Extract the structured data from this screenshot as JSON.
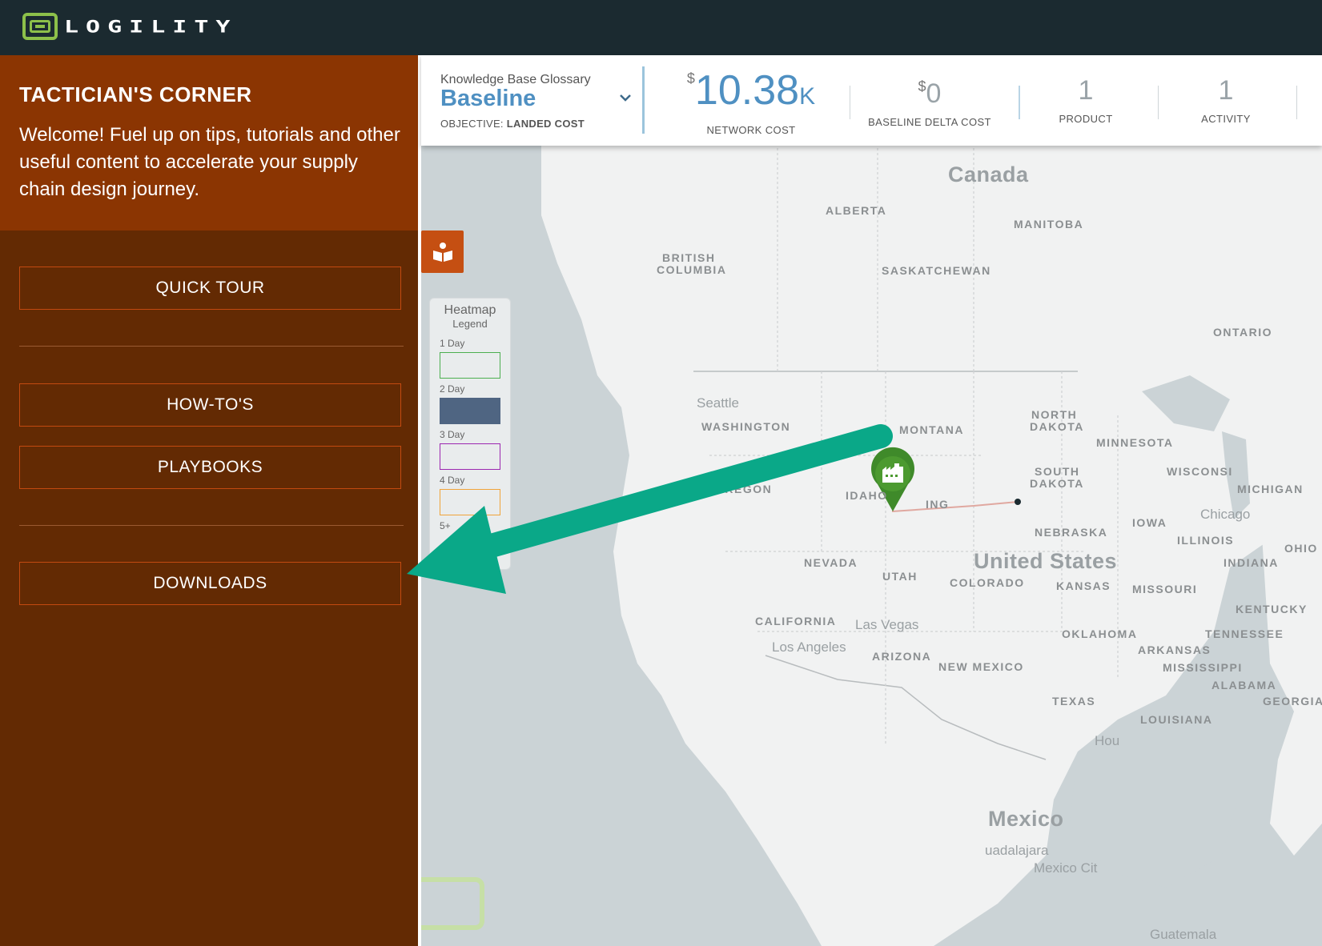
{
  "brand": {
    "name": "LOGILITY",
    "accent": "#8dc04a",
    "topbar_bg": "#1b2a30"
  },
  "panel": {
    "title": "TACTICIAN'S CORNER",
    "welcome": "Welcome! Fuel up on tips, tutorials and other useful content to accelerate your supply chain design journey.",
    "buttons": {
      "quick_tour": "QUICK TOUR",
      "how_tos": "HOW-TO'S",
      "playbooks": "PLAYBOOKS",
      "downloads": "DOWNLOADS"
    },
    "colors": {
      "header": "#8b3502",
      "body": "#632a03",
      "border": "#c34a10"
    }
  },
  "scenario": {
    "kb_label": "Knowledge Base Glossary",
    "name": "Baseline",
    "objective_label": "OBJECTIVE:",
    "objective_value": "LANDED COST"
  },
  "metrics": {
    "network_cost": {
      "currency": "$",
      "value": "10.38",
      "suffix": "K",
      "label": "NETWORK COST"
    },
    "baseline_delta": {
      "currency": "$",
      "value": "0",
      "label": "BASELINE DELTA COST"
    },
    "product": {
      "value": "1",
      "label": "PRODUCT"
    },
    "activity": {
      "value": "1",
      "label": "ACTIVITY"
    }
  },
  "legend": {
    "title": "Heatmap",
    "subtitle": "Legend",
    "items": [
      {
        "label": "1 Day",
        "color": "#4caf50",
        "filled": false
      },
      {
        "label": "2 Day",
        "color": "#4f6582",
        "filled": true
      },
      {
        "label": "3 Day",
        "color": "#9c27b0",
        "filled": false
      },
      {
        "label": "4 Day",
        "color": "#f0a43a",
        "filled": false
      },
      {
        "label": "5+",
        "color": "#d9534f",
        "filled": false
      }
    ]
  },
  "map": {
    "countries": {
      "canada": "Canada",
      "us": "United States",
      "mexico": "Mexico"
    },
    "regions": {
      "alberta": "ALBERTA",
      "manitoba": "MANITOBA",
      "british_columbia_1": "BRITISH",
      "british_columbia_2": "COLUMBIA",
      "saskatchewan": "SASKATCHEWAN",
      "ontario": "ONTARIO",
      "washington": "WASHINGTON",
      "montana": "MONTANA",
      "north_dakota_1": "NORTH",
      "north_dakota_2": "DAKOTA",
      "minnesota": "MINNESOTA",
      "south_dakota_1": "SOUTH",
      "south_dakota_2": "DAKOTA",
      "wisconsin": "WISCONSI",
      "michigan": "MICHIGAN",
      "oregon": "OREGON",
      "idaho": "IDAHO",
      "wyoming": "ING",
      "iowa": "IOWA",
      "nebraska": "NEBRASKA",
      "illinois": "ILLINOIS",
      "ohio": "OHIO",
      "nevada": "NEVADA",
      "utah": "UTAH",
      "colorado": "COLORADO",
      "kansas": "KANSAS",
      "missouri": "MISSOURI",
      "indiana": "INDIANA",
      "kentucky": "KENTUCKY",
      "california": "CALIFORNIA",
      "oklahoma": "OKLAHOMA",
      "tennessee": "TENNESSEE",
      "arizona": "ARIZONA",
      "new_mexico": "NEW MEXICO",
      "arkansas": "ARKANSAS",
      "mississippi": "MISSISSIPPI",
      "alabama": "ALABAMA",
      "georgia": "GEORGIA",
      "texas": "TEXAS",
      "louisiana": "LOUISIANA",
      "guatemala": "Guatemala"
    },
    "cities": {
      "seattle": "Seattle",
      "las_vegas": "Las Vegas",
      "los_angeles": "Los Angeles",
      "chicago": "Chicago",
      "houston": "Hou",
      "guadalajara": "uadalajara",
      "mexico_city": "Mexico Cit"
    }
  }
}
